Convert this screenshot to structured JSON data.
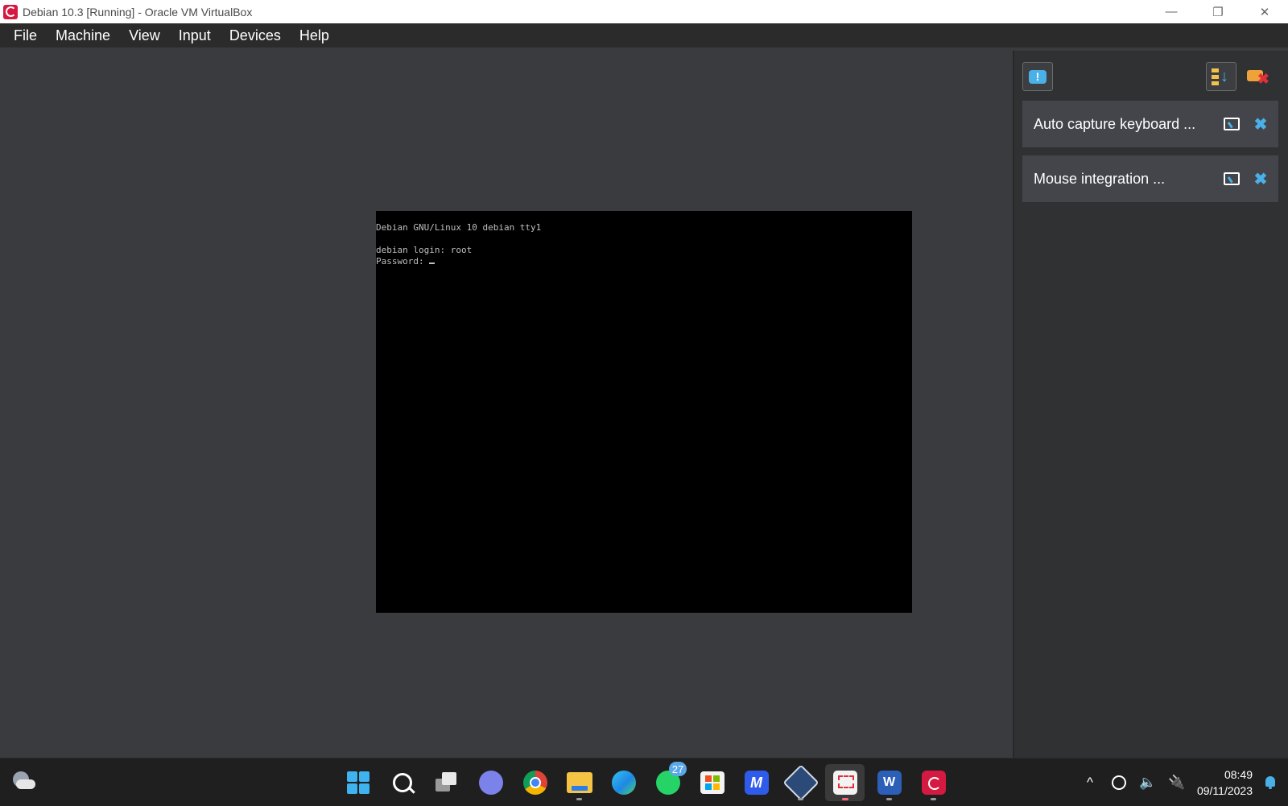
{
  "window": {
    "title": "Debian 10.3 [Running] - Oracle VM VirtualBox",
    "controls": {
      "minimize": "—",
      "restore": "❐",
      "close": "✕"
    }
  },
  "menu": {
    "items": [
      "File",
      "Machine",
      "View",
      "Input",
      "Devices",
      "Help"
    ]
  },
  "console": {
    "line1": "Debian GNU/Linux 10 debian tty1",
    "line2": "",
    "line3": "debian login: root",
    "line4": "Password: "
  },
  "notification_center": {
    "notifications": [
      {
        "text": "Auto capture keyboard ..."
      },
      {
        "text": "Mouse integration ..."
      }
    ],
    "close_glyph": "✖",
    "bubble_glyph": "!"
  },
  "taskbar": {
    "apps": [
      {
        "icon": "start-icon"
      },
      {
        "icon": "search-icon"
      },
      {
        "icon": "task-view-icon"
      },
      {
        "icon": "teams-icon"
      },
      {
        "icon": "chrome-icon"
      },
      {
        "icon": "file-explorer-icon"
      },
      {
        "icon": "edge-icon"
      },
      {
        "icon": "whatsapp-icon",
        "badge": "27"
      },
      {
        "icon": "microsoft-store-icon"
      },
      {
        "icon": "m-app-icon",
        "glyph": "M"
      },
      {
        "icon": "virtualbox-icon"
      },
      {
        "icon": "snipping-tool-icon"
      },
      {
        "icon": "word-icon",
        "glyph": "W"
      },
      {
        "icon": "debian-icon"
      }
    ],
    "tray": {
      "chevron": "^",
      "speaker": "🔈",
      "battery": "🔌",
      "time": "08:49",
      "date": "09/11/2023"
    }
  },
  "colors": {
    "accent": "#4ab0e8",
    "debian_red": "#d51a42",
    "vm_background": "#3a3b3e"
  }
}
